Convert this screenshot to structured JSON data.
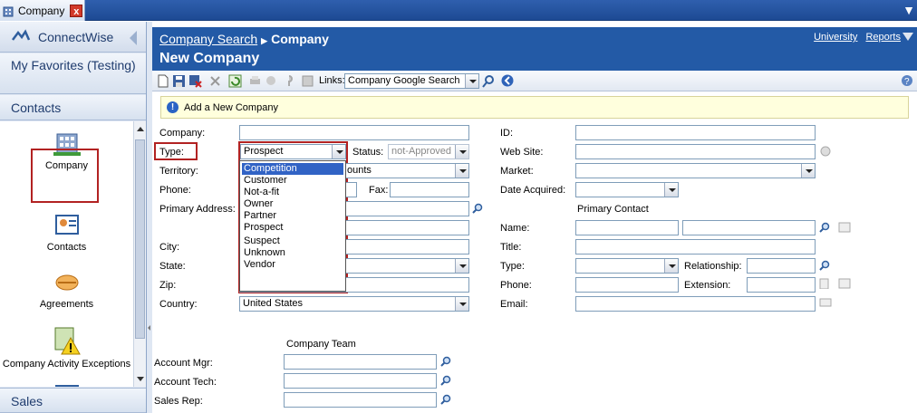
{
  "window": {
    "tab_label": "Company",
    "tab_close": "x"
  },
  "nav": {
    "app_title": "ConnectWise",
    "favorites": "My Favorites (Testing)",
    "contacts": "Contacts",
    "sales": "Sales",
    "items": [
      {
        "label": "Company",
        "icon": "building-icon"
      },
      {
        "label": "Contacts",
        "icon": "contact-card-icon"
      },
      {
        "label": "Agreements",
        "icon": "handshake-icon"
      },
      {
        "label": "Company Activity Exceptions",
        "icon": "warning-icon"
      },
      {
        "label": "",
        "icon": "contact-card-icon"
      }
    ]
  },
  "header": {
    "breadcrumb_link": "Company Search",
    "breadcrumb_current": "Company",
    "title": "New Company",
    "links": [
      "University",
      "Reports"
    ]
  },
  "toolbar": {
    "links_label": "Links:",
    "links_value": "Company Google Search"
  },
  "info": {
    "message": "Add a New Company"
  },
  "form": {
    "company_label": "Company:",
    "company_value": "",
    "type_label": "Type:",
    "type_value": "Prospect",
    "status_label": "Status:",
    "status_value": "not-Approved",
    "territory_label": "Territory:",
    "territory_value": "ounts",
    "phone_label": "Phone:",
    "fax_label": "Fax:",
    "primary_address_label": "Primary Address:",
    "city_label": "City:",
    "state_label": "State:",
    "zip_label": "Zip:",
    "country_label": "Country:",
    "country_value": "United States",
    "id_label": "ID:",
    "website_label": "Web Site:",
    "market_label": "Market:",
    "date_acquired_label": "Date Acquired:",
    "primary_contact_heading": "Primary Contact",
    "name_label": "Name:",
    "title_label": "Title:",
    "contact_type_label": "Type:",
    "relationship_label": "Relationship:",
    "contact_phone_label": "Phone:",
    "extension_label": "Extension:",
    "email_label": "Email:",
    "company_team_heading": "Company Team",
    "account_mgr_label": "Account Mgr:",
    "account_tech_label": "Account Tech:",
    "sales_rep_label": "Sales Rep:"
  },
  "type_options": [
    "Competition",
    "Customer",
    "Not-a-fit",
    "Owner",
    "Partner",
    "Prospect",
    "Suspect",
    "Unknown",
    "Vendor"
  ],
  "type_selected_option": "Competition",
  "colors": {
    "header_blue": "#235aa6",
    "highlight_red": "#b22222",
    "selection_blue": "#3163c5",
    "info_yellow": "#ffffdd"
  }
}
